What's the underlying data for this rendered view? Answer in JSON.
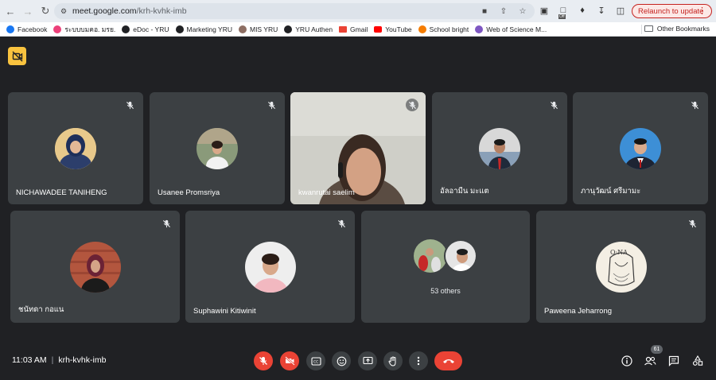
{
  "browser": {
    "url_host": "meet.google.com",
    "url_path": "/krh-kvhk-imb",
    "relaunch_label": "Relaunch to update",
    "ext_off_label": "Off"
  },
  "bookmarks": [
    {
      "label": "Facebook",
      "color": "#1877f2"
    },
    {
      "label": "ระบบบมคอ. มรย.",
      "color": "#c2185b"
    },
    {
      "label": "eDoc - YRU",
      "color": "#202124"
    },
    {
      "label": "Marketing YRU",
      "color": "#202124"
    },
    {
      "label": "MIS YRU",
      "color": "#6d4c41"
    },
    {
      "label": "YRU Authen",
      "color": "#202124"
    },
    {
      "label": "Gmail",
      "color": "#ea4335"
    },
    {
      "label": "YouTube",
      "color": "#ff0000"
    },
    {
      "label": "School bright",
      "color": "#f57c00"
    },
    {
      "label": "Web of Science M...",
      "color": "#7e57c2"
    }
  ],
  "bookmarks_other": "Other Bookmarks",
  "participants_row1": [
    {
      "name": "NICHAWADEE TANIHENG"
    },
    {
      "name": "Usanee Promsriya"
    },
    {
      "name": "kwanrutai saelim"
    },
    {
      "name": "อัลอามีน มะแต"
    },
    {
      "name": "ภานุวัฒน์ ศรีมามะ"
    }
  ],
  "participants_row2": [
    {
      "name": "ชนัทดา กอแน"
    },
    {
      "name": "Suphawini Kitiwinit"
    },
    {
      "name": "53 others"
    },
    {
      "name": "Paweena Jeharrong"
    }
  ],
  "meeting": {
    "time": "11:03 AM",
    "code": "krh-kvhk-imb",
    "participant_count": "61"
  },
  "controls": [
    "mic-off",
    "camera-off",
    "captions",
    "emoji",
    "present",
    "raise-hand",
    "more",
    "leave-call"
  ],
  "colors": {
    "accent_red": "#ea4335",
    "tile_bg": "#3c4043",
    "page_bg": "#202124",
    "cam_off_badge": "#f9c33f"
  }
}
